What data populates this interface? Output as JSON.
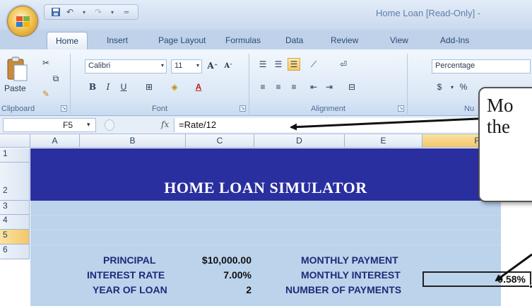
{
  "titlebar": {
    "title": "Home Loan  [Read-Only] - "
  },
  "quick_access": {
    "icons": [
      "save-icon",
      "undo-icon",
      "redo-icon",
      "customize-icon"
    ]
  },
  "tabs": [
    "Home",
    "Insert",
    "Page Layout",
    "Formulas",
    "Data",
    "Review",
    "View",
    "Add-Ins"
  ],
  "ribbon": {
    "clipboard": {
      "paste_label": "Paste",
      "group_label": "Clipboard"
    },
    "font": {
      "font_name": "Calibri",
      "font_size": "11",
      "group_label": "Font",
      "bold": "B",
      "italic": "I",
      "underline": "U"
    },
    "alignment": {
      "group_label": "Alignment"
    },
    "number": {
      "format": "Percentage",
      "currency": "$",
      "percent": "%",
      "group_label": "Nu"
    }
  },
  "formula_bar": {
    "name_box": "F5",
    "fx_label": "fx",
    "formula": "=Rate/12"
  },
  "columns": [
    "A",
    "B",
    "C",
    "D",
    "E",
    "F"
  ],
  "rows": [
    "1",
    "2",
    "3",
    "4",
    "5",
    "6"
  ],
  "sheet": {
    "banner_title": "HOME LOAN SIMULATOR",
    "rows": [
      {
        "label": "PRINCIPAL",
        "value": "$10,000.00",
        "label2": "MONTHLY PAYMENT",
        "value2": ""
      },
      {
        "label": "INTEREST RATE",
        "value": "7.00%",
        "label2": "MONTHLY INTEREST",
        "value2": "0.58%"
      },
      {
        "label": "YEAR OF LOAN",
        "value": "2",
        "label2": "NUMBER OF PAYMENTS",
        "value2": ""
      }
    ]
  },
  "callout": {
    "line1": "Mo",
    "line2": "the"
  },
  "colors": {
    "banner": "#2a2fa0",
    "data_fill": "#bcd3ec",
    "label_text": "#1c2b78"
  }
}
